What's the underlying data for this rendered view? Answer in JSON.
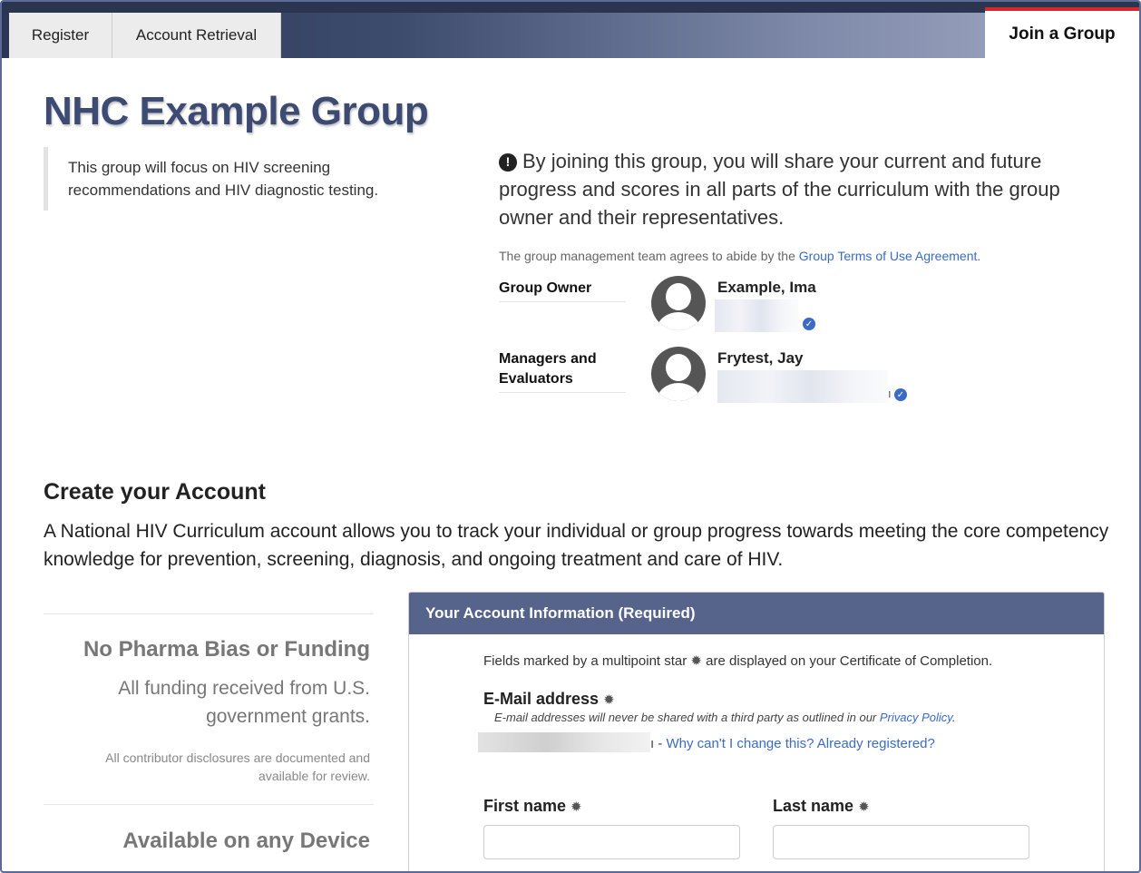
{
  "nav": {
    "tabs": [
      "Register",
      "Account Retrieval"
    ],
    "active_tab": "Join a Group",
    "accent_color": "#d9262c"
  },
  "group": {
    "title": "NHC Example Group",
    "description": "This group will focus on HIV screening recommendations and HIV diagnostic testing.",
    "notice": "By joining this group, you will share your current and future progress and scores in all parts of the curriculum with the group owner and their representatives.",
    "terms_prefix": "The group management team agrees to abide by the ",
    "terms_link": "Group Terms of Use Agreement.",
    "owner_label": "Group Owner",
    "owner_name": "Example, Ima",
    "managers_label": "Managers and Evaluators",
    "manager_name": "Frytest, Jay",
    "manager_email_tail": "ı"
  },
  "create": {
    "title": "Create your Account",
    "description": "A National HIV Curriculum account allows you to track your individual or group progress towards meeting the core competency knowledge for prevention, screening, diagnosis, and ongoing treatment and care of HIV."
  },
  "features": [
    {
      "title": "No Pharma Bias or Funding",
      "subtitle": "All funding received from U.S. government grants.",
      "note": "All contributor disclosures are documented and available for review."
    },
    {
      "title": "Available on any Device"
    }
  ],
  "form": {
    "header": "Your Account Information (Required)",
    "note_prefix": "Fields marked by a multipoint star ",
    "note_suffix": " are displayed on your Certificate of Completion.",
    "email_label": "E-Mail address",
    "email_hint_prefix": "E-mail addresses will never be shared with a third party as outlined in our ",
    "email_hint_link": "Privacy Policy",
    "email_hint_suffix": ".",
    "email_value_tail": "ı - ",
    "email_change_link": "Why can't I change this? Already registered?",
    "first_name_label": "First name",
    "last_name_label": "Last name"
  }
}
